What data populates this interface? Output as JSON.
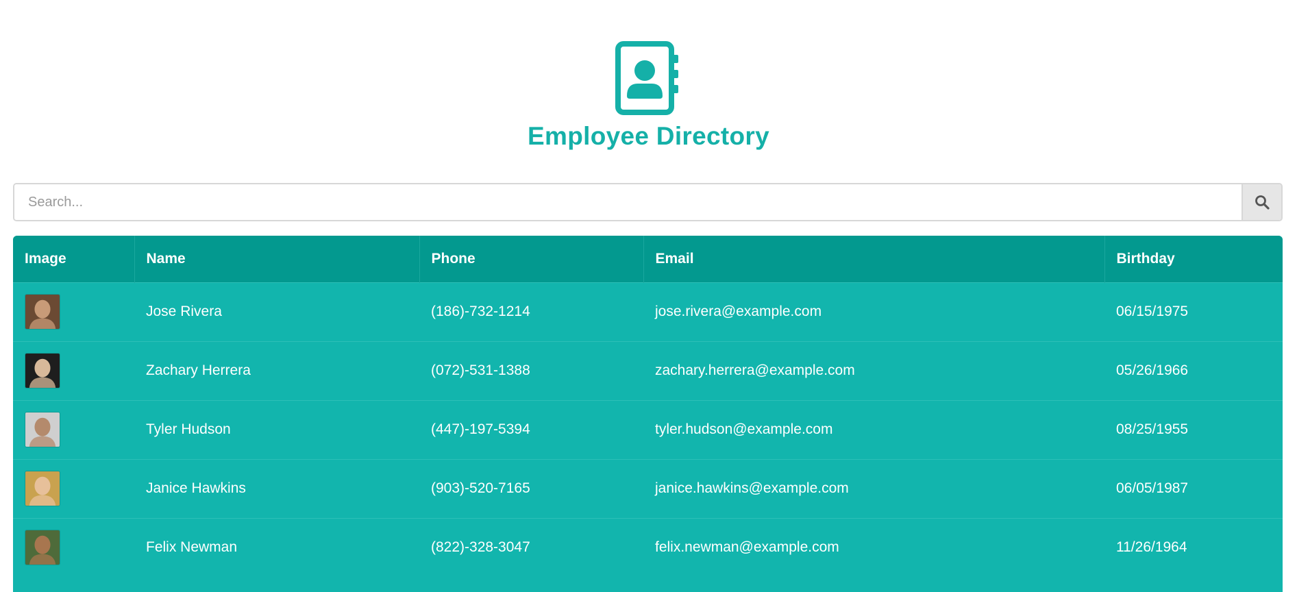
{
  "header": {
    "title": "Employee Directory",
    "logo_icon": "contact-book-icon",
    "accent_color": "#15b0a8"
  },
  "search": {
    "placeholder": "Search...",
    "value": "",
    "button_icon": "search-icon"
  },
  "table": {
    "header_color": "#03998f",
    "row_color": "#12b5ad",
    "columns": [
      "Image",
      "Name",
      "Phone",
      "Email",
      "Birthday"
    ],
    "rows": [
      {
        "name": "Jose Rivera",
        "phone": "(186)-732-1214",
        "email": "jose.rivera@example.com",
        "birthday": "06/15/1975",
        "avatar_colors": [
          "#6b4a33",
          "#c89b78"
        ]
      },
      {
        "name": "Zachary Herrera",
        "phone": "(072)-531-1388",
        "email": "zachary.herrera@example.com",
        "birthday": "05/26/1966",
        "avatar_colors": [
          "#1e1e1e",
          "#d8b99a"
        ]
      },
      {
        "name": "Tyler Hudson",
        "phone": "(447)-197-5394",
        "email": "tyler.hudson@example.com",
        "birthday": "08/25/1955",
        "avatar_colors": [
          "#cfcfcf",
          "#b48a6c"
        ]
      },
      {
        "name": "Janice Hawkins",
        "phone": "(903)-520-7165",
        "email": "janice.hawkins@example.com",
        "birthday": "06/05/1987",
        "avatar_colors": [
          "#c9a24f",
          "#e7c09a"
        ]
      },
      {
        "name": "Felix Newman",
        "phone": "(822)-328-3047",
        "email": "felix.newman@example.com",
        "birthday": "11/26/1964",
        "avatar_colors": [
          "#4e6b3a",
          "#a8764f"
        ]
      }
    ]
  }
}
